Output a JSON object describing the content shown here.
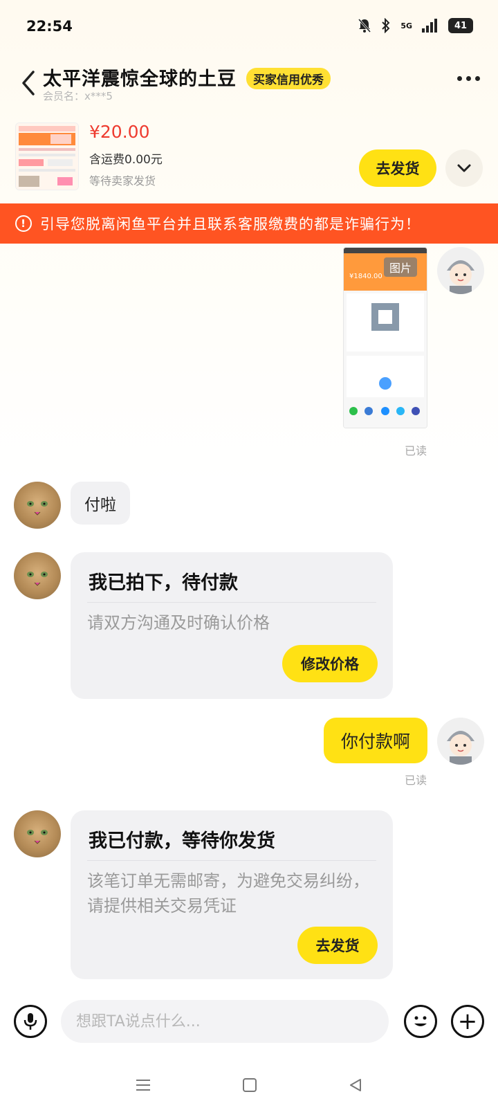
{
  "status": {
    "time": "22:54",
    "network": "5G",
    "battery": "41"
  },
  "header": {
    "title": "太平洋震惊全球的土豆",
    "badge": "买家信用优秀",
    "member": "会员名：x***5"
  },
  "product": {
    "price": "¥20.00",
    "shipping": "含运费0.00元",
    "status": "等待卖家发货",
    "ship_button": "去发货"
  },
  "warning": "引导您脱离闲鱼平台并且联系客服缴费的都是诈骗行为！",
  "messages": {
    "image_tag": "图片",
    "image_price": "¥1840.00",
    "read1": "已读",
    "buyer_text1": "付啦",
    "card1": {
      "title": "我已拍下，待付款",
      "desc": "请双方沟通及时确认价格",
      "button": "修改价格"
    },
    "seller_text1": "你付款啊",
    "read2": "已读",
    "card2": {
      "title": "我已付款，等待你发货",
      "desc": "该笔订单无需邮寄，为避免交易纠纷，请提供相关交易凭证",
      "button": "去发货"
    }
  },
  "input": {
    "placeholder": "想跟TA说点什么..."
  },
  "colors": {
    "accent": "#ffe114",
    "warning": "#ff5422",
    "price": "#ee3b2f"
  }
}
